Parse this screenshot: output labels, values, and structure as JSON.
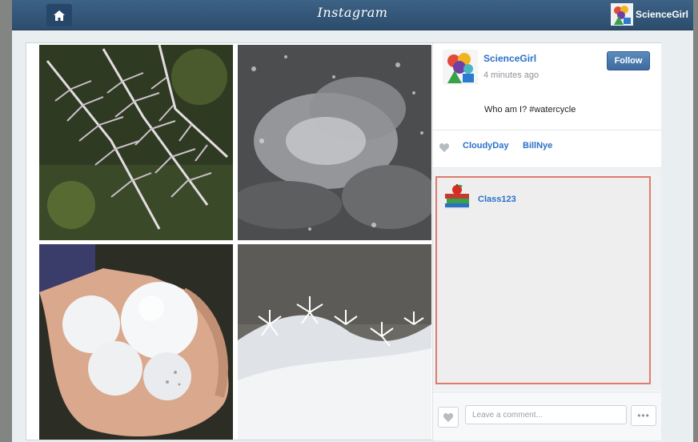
{
  "app": {
    "title": "Instagram"
  },
  "header": {
    "user_name": "ScienceGirl"
  },
  "post": {
    "owner": "ScienceGirl",
    "time": "4 minutes ago",
    "follow_label": "Follow",
    "caption": "Who am I? #watercycle",
    "likes": [
      "CloudyDay",
      "BillNye"
    ],
    "comments": [
      {
        "author": "Class123"
      }
    ]
  },
  "compose": {
    "placeholder": "Leave a comment...",
    "more_label": "•••"
  },
  "colors": {
    "topbar": "#2c4d6d",
    "link": "#2a71c9",
    "highlight": "#e07b6f"
  }
}
